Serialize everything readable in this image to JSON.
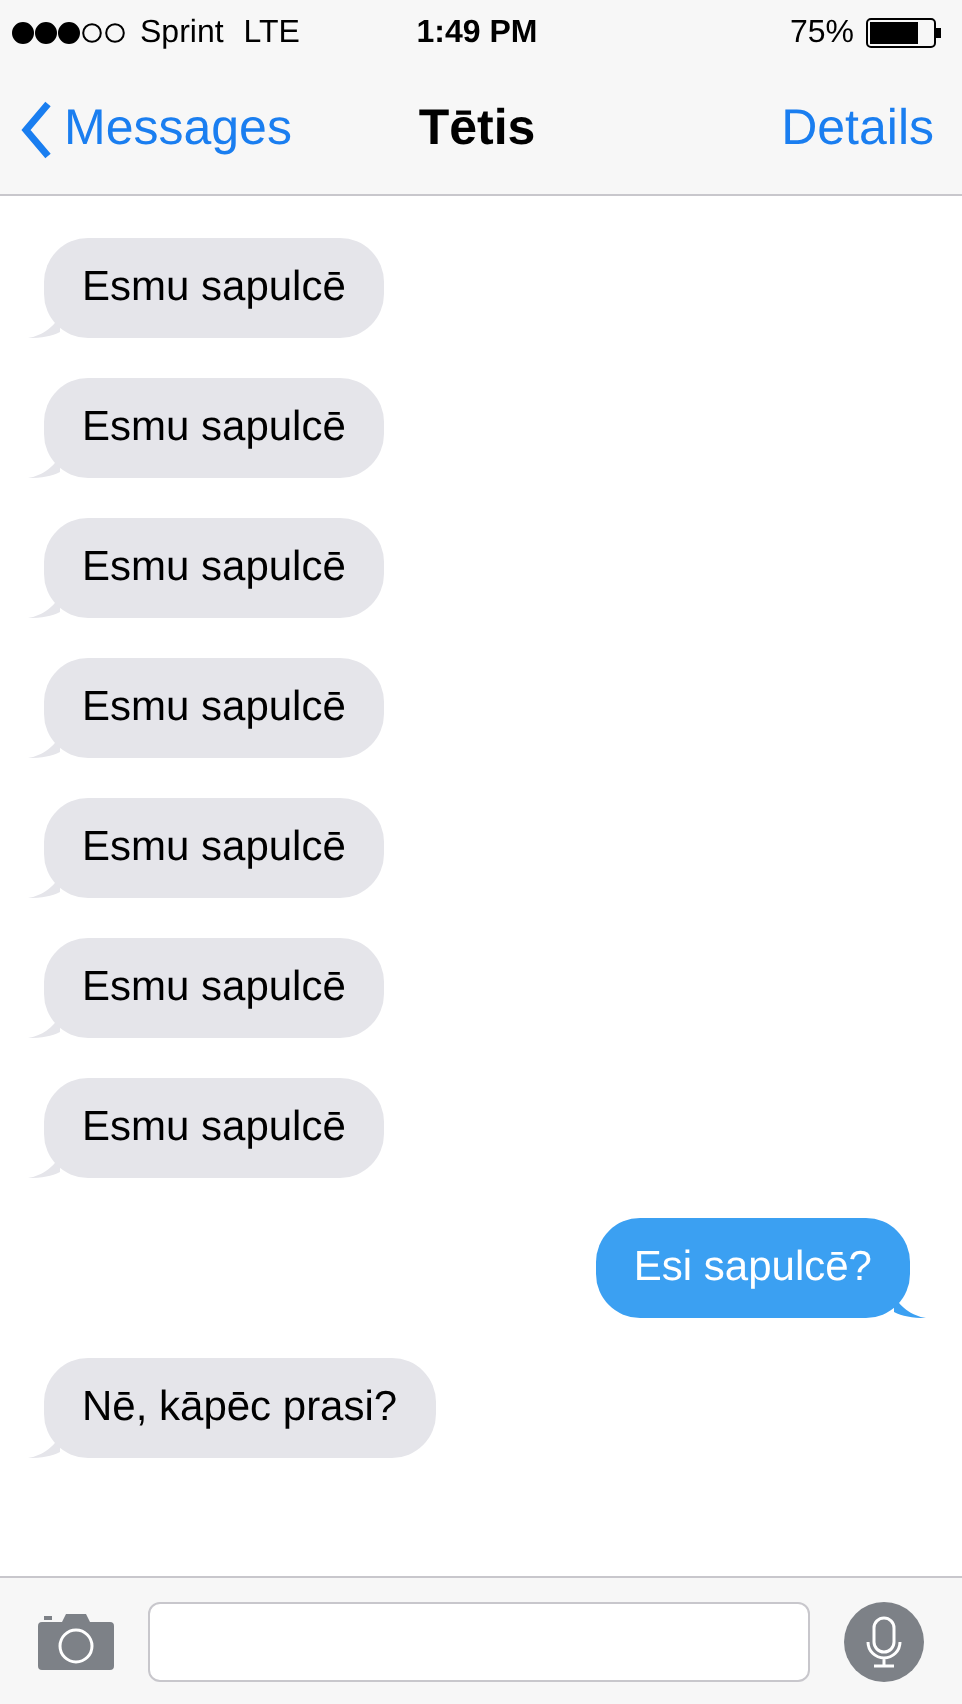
{
  "status_bar": {
    "carrier": "Sprint",
    "network": "LTE",
    "time": "1:49 PM",
    "battery": "75%"
  },
  "nav": {
    "back": "Messages",
    "title": "Tētis",
    "action": "Details"
  },
  "messages": [
    {
      "kind": "received",
      "text": "Esmu sapulcē"
    },
    {
      "kind": "received",
      "text": "Esmu sapulcē"
    },
    {
      "kind": "received",
      "text": "Esmu sapulcē"
    },
    {
      "kind": "received",
      "text": "Esmu sapulcē"
    },
    {
      "kind": "received",
      "text": "Esmu sapulcē"
    },
    {
      "kind": "received",
      "text": "Esmu sapulcē"
    },
    {
      "kind": "received",
      "text": "Esmu sapulcē"
    },
    {
      "kind": "sent",
      "text": "Esi sapulcē?"
    },
    {
      "kind": "received",
      "text": "Nē, kāpēc prasi?"
    }
  ]
}
